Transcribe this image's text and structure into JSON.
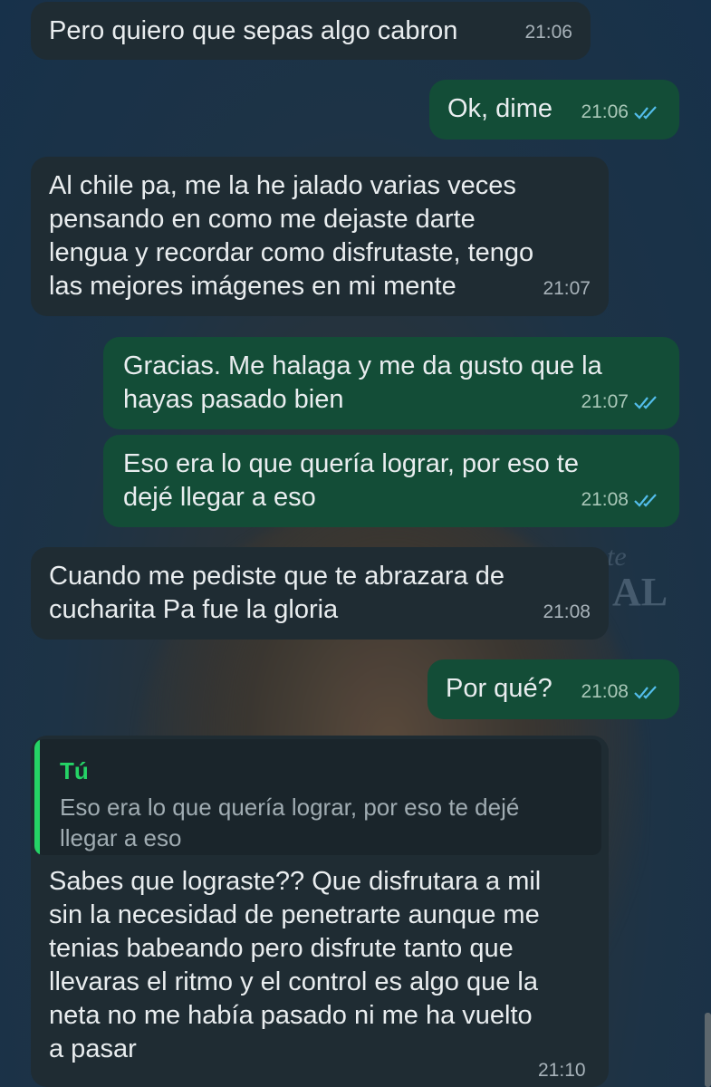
{
  "messages": [
    {
      "text": "Pero quiero que sepas algo cabron",
      "time": "21:06"
    },
    {
      "text": "Ok, dime",
      "time": "21:06"
    },
    {
      "lines": [
        "Al chile pa, me la he jalado varias veces",
        "pensando en como me dejaste darte",
        "lengua y recordar como disfrutaste, tengo",
        "las mejores imágenes en mi mente"
      ],
      "time": "21:07"
    },
    {
      "lines": [
        "Gracias. Me halaga y me da gusto que la",
        "hayas pasado bien"
      ],
      "time": "21:07"
    },
    {
      "lines": [
        "Eso era lo que quería lograr, por eso te",
        "dejé llegar a eso"
      ],
      "time": "21:08"
    },
    {
      "lines": [
        "Cuando me pediste que te abrazara de",
        "cucharita Pa fue la gloria"
      ],
      "time": "21:08"
    },
    {
      "text": "Por qué?",
      "time": "21:08"
    },
    {
      "quote": {
        "author": "Tú",
        "lines": [
          "Eso era lo que quería lograr, por eso te dejé",
          "llegar a eso"
        ]
      },
      "lines": [
        "Sabes que lograste?? Que disfrutara a mil",
        "sin la necesidad de penetrarte aunque me",
        "tenias babeando pero disfrute tanto que",
        "llevaras el ritmo y el control es algo que la",
        "neta no me había pasado ni me ha vuelto",
        "a pasar"
      ],
      "time": "21:10"
    }
  ],
  "background_text": [
    "ante",
    "AL"
  ],
  "colors": {
    "incoming": "#1f2c33",
    "outgoing": "#134d37",
    "read_tick": "#53bdeb",
    "quote_accent": "#25d366"
  },
  "icons": {
    "read_receipt": "double-check-icon"
  }
}
